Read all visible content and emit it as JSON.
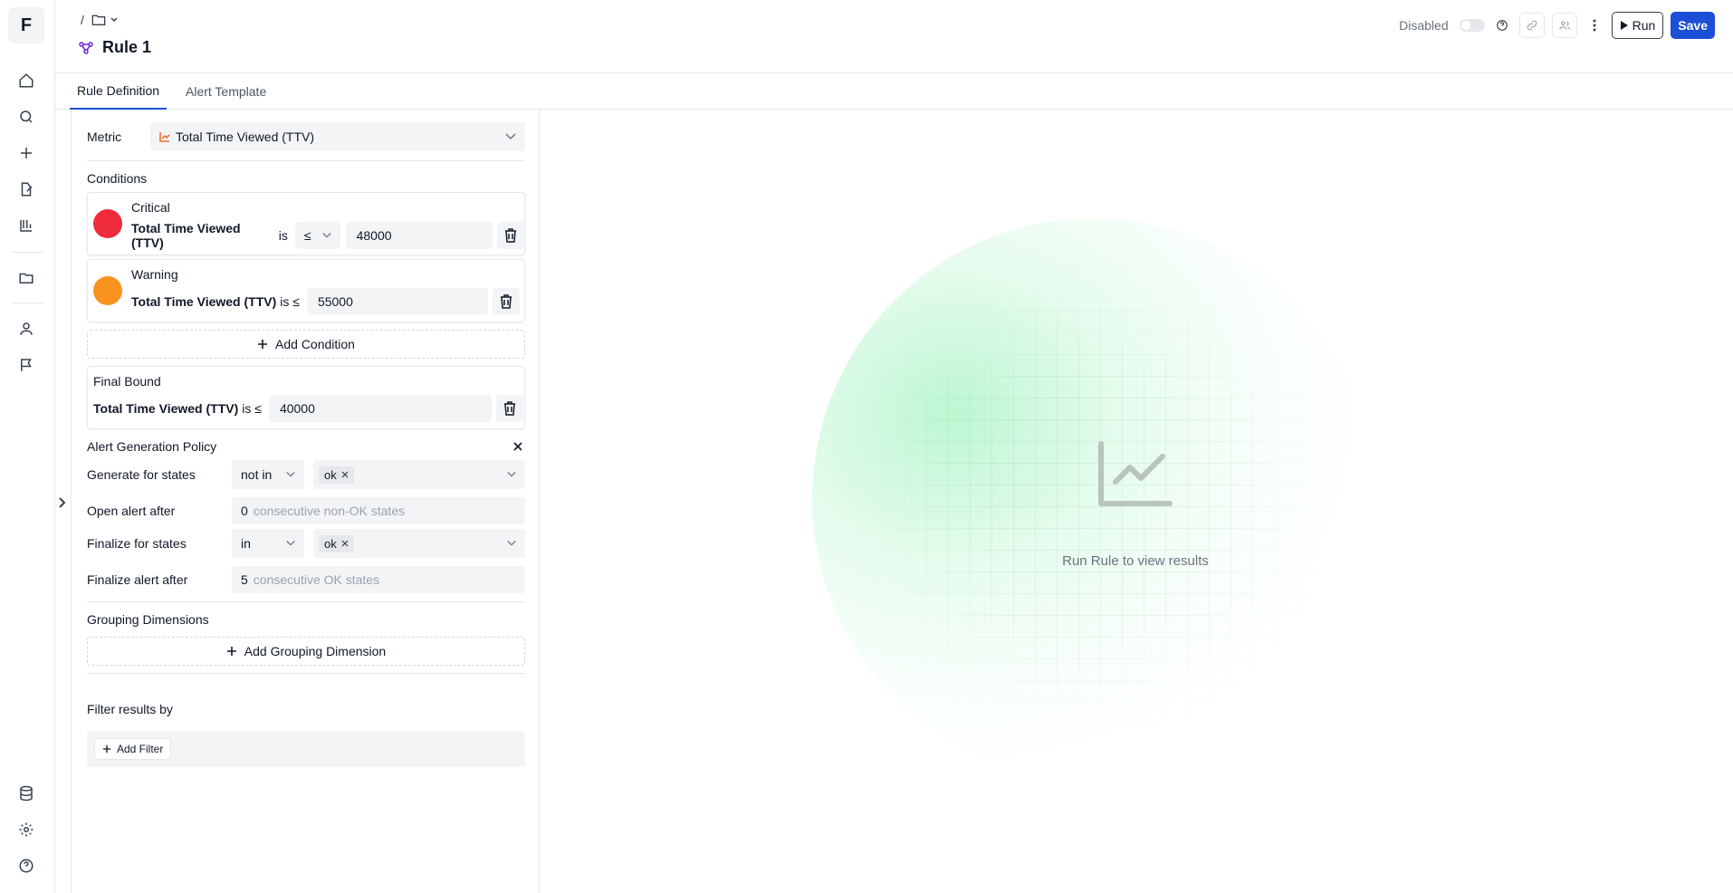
{
  "app": {
    "logo_letter": "F"
  },
  "nav": {
    "items": [
      {
        "name": "home-icon"
      },
      {
        "name": "search-icon"
      },
      {
        "name": "plus-icon"
      },
      {
        "name": "edit-document-icon"
      },
      {
        "name": "lab-flask-icon"
      },
      {
        "name": "folder-icon"
      },
      {
        "name": "user-icon"
      },
      {
        "name": "flag-icon"
      },
      {
        "name": "database-icon"
      },
      {
        "name": "gear-icon"
      },
      {
        "name": "help-icon"
      }
    ]
  },
  "header": {
    "breadcrumb_sep": "/",
    "title": "Rule 1",
    "status_label": "Disabled",
    "run_label": "Run",
    "save_label": "Save"
  },
  "tabs": [
    {
      "label": "Rule Definition",
      "active": true
    },
    {
      "label": "Alert Template",
      "active": false
    }
  ],
  "metric": {
    "label": "Metric",
    "value": "Total Time Viewed (TTV)"
  },
  "conditions": {
    "heading": "Conditions",
    "items": [
      {
        "name": "Critical",
        "color": "#ef2b3c",
        "metric": "Total Time Viewed (TTV)",
        "is": "is",
        "operator": "≤",
        "value": "48000"
      },
      {
        "name": "Warning",
        "color": "#f7931e",
        "metric": "Total Time Viewed (TTV)",
        "is": "is ≤",
        "value": "55000"
      }
    ],
    "add_label": "Add Condition",
    "final_bound": {
      "name": "Final Bound",
      "metric": "Total Time Viewed (TTV)",
      "is": "is ≤",
      "value": "40000"
    }
  },
  "policy": {
    "heading": "Alert Generation Policy",
    "generate_label": "Generate for states",
    "generate_op": "not in",
    "generate_chip": "ok",
    "open_label": "Open alert after",
    "open_value": "0",
    "open_suffix": "consecutive non-OK states",
    "finalize_label": "Finalize for states",
    "finalize_op": "in",
    "finalize_chip": "ok",
    "finalize_after_label": "Finalize alert after",
    "finalize_after_value": "5",
    "finalize_after_suffix": "consecutive OK states"
  },
  "grouping": {
    "heading": "Grouping Dimensions",
    "add_label": "Add Grouping Dimension"
  },
  "filter": {
    "heading": "Filter results by",
    "add_label": "Add Filter"
  },
  "results": {
    "empty_text": "Run Rule to view results"
  }
}
